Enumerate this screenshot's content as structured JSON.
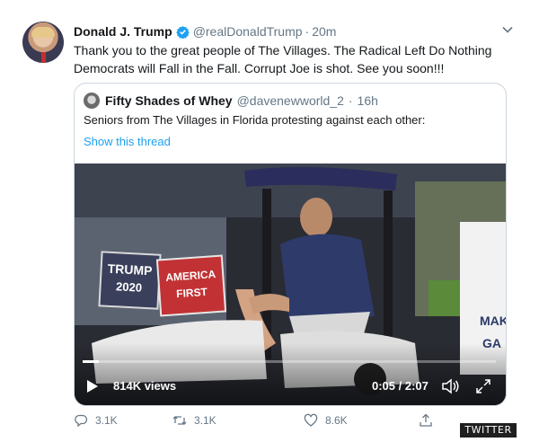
{
  "tweet": {
    "author_name": "Donald J. Trump",
    "author_handle": "@realDonaldTrump",
    "separator": "·",
    "time": "20m",
    "text": "Thank you to the great people of The Villages. The Radical Left Do Nothing Democrats will Fall in the Fall. Corrupt Joe is shot. See you soon!!!"
  },
  "quoted": {
    "author_name": "Fifty Shades of Whey",
    "author_handle": "@davenewworld_2",
    "separator": "·",
    "time": "16h",
    "text": "Seniors from The Villages in Florida protesting against each other:",
    "thread_link": "Show this thread",
    "video": {
      "views": "814K views",
      "timecode": "0:05 / 2:07",
      "progress": 0.04,
      "sign_left_line1": "TRUMP",
      "sign_left_line2": "2020",
      "sign_right_line1": "AMERICA",
      "sign_right_line2": "FIRST",
      "sign_partial_line1": "MAK",
      "sign_partial_line2": "GA"
    }
  },
  "actions": {
    "reply_count": "3.1K",
    "retweet_count": "3.1K",
    "like_count": "8.6K"
  },
  "watermark": "TWITTER",
  "colors": {
    "link": "#1da1f2",
    "muted": "#657786",
    "border": "#ccd6dd",
    "verified": "#1da1f2"
  },
  "icons": [
    "verified-icon",
    "caret-down-icon",
    "play-icon",
    "volume-icon",
    "fullscreen-icon",
    "reply-icon",
    "retweet-icon",
    "like-icon",
    "share-icon"
  ]
}
